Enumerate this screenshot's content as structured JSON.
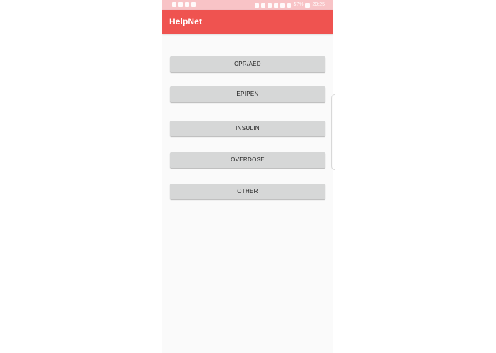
{
  "status_bar": {
    "time": "20:25",
    "battery": "57%"
  },
  "app_bar": {
    "title": "HelpNet"
  },
  "buttons": [
    {
      "label": "CPR/AED"
    },
    {
      "label": "EPIPEN"
    },
    {
      "label": "INSULIN"
    },
    {
      "label": "OVERDOSE"
    },
    {
      "label": "OTHER"
    }
  ],
  "colors": {
    "status_bar": "#f8c3c6",
    "app_bar": "#ef5350",
    "background": "#fafafa",
    "button": "#d6d7d7"
  }
}
